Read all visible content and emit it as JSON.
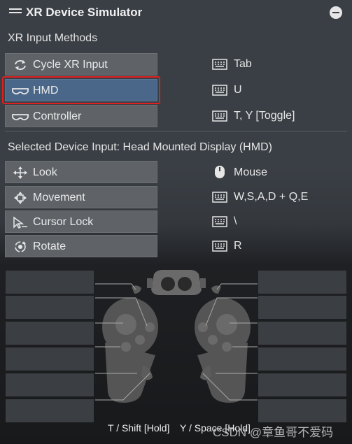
{
  "header": {
    "title": "XR Device Simulator"
  },
  "input_methods": {
    "heading": "XR Input Methods",
    "items": [
      {
        "label": "Cycle XR Input",
        "shortcut": "Tab",
        "icon": "cycle-icon"
      },
      {
        "label": "HMD",
        "shortcut": "U",
        "icon": "hmd-icon",
        "selected": true
      },
      {
        "label": "Controller",
        "shortcut": "T, Y [Toggle]",
        "icon": "controller-icon"
      }
    ]
  },
  "device_input": {
    "heading": "Selected Device Input: Head Mounted Display (HMD)",
    "items": [
      {
        "label": "Look",
        "shortcut": "Mouse",
        "icon": "look-icon",
        "shortcut_icon": "mouse-icon"
      },
      {
        "label": "Movement",
        "shortcut": "W,S,A,D + Q,E",
        "icon": "movement-icon",
        "shortcut_icon": "keyboard-icon"
      },
      {
        "label": "Cursor Lock",
        "shortcut": "\\",
        "icon": "cursor-lock-icon",
        "shortcut_icon": "keyboard-icon"
      },
      {
        "label": "Rotate",
        "shortcut": "R",
        "icon": "rotate-icon",
        "shortcut_icon": "keyboard-icon"
      }
    ]
  },
  "footer": {
    "hint_left": "T / Shift [Hold]",
    "hint_right": "Y / Space [Hold]",
    "watermark": "CSDN @章鱼哥不爱码"
  },
  "colors": {
    "accent_selected": "#4a6688",
    "button": "#5f6368",
    "highlight_ring": "#e02020"
  }
}
